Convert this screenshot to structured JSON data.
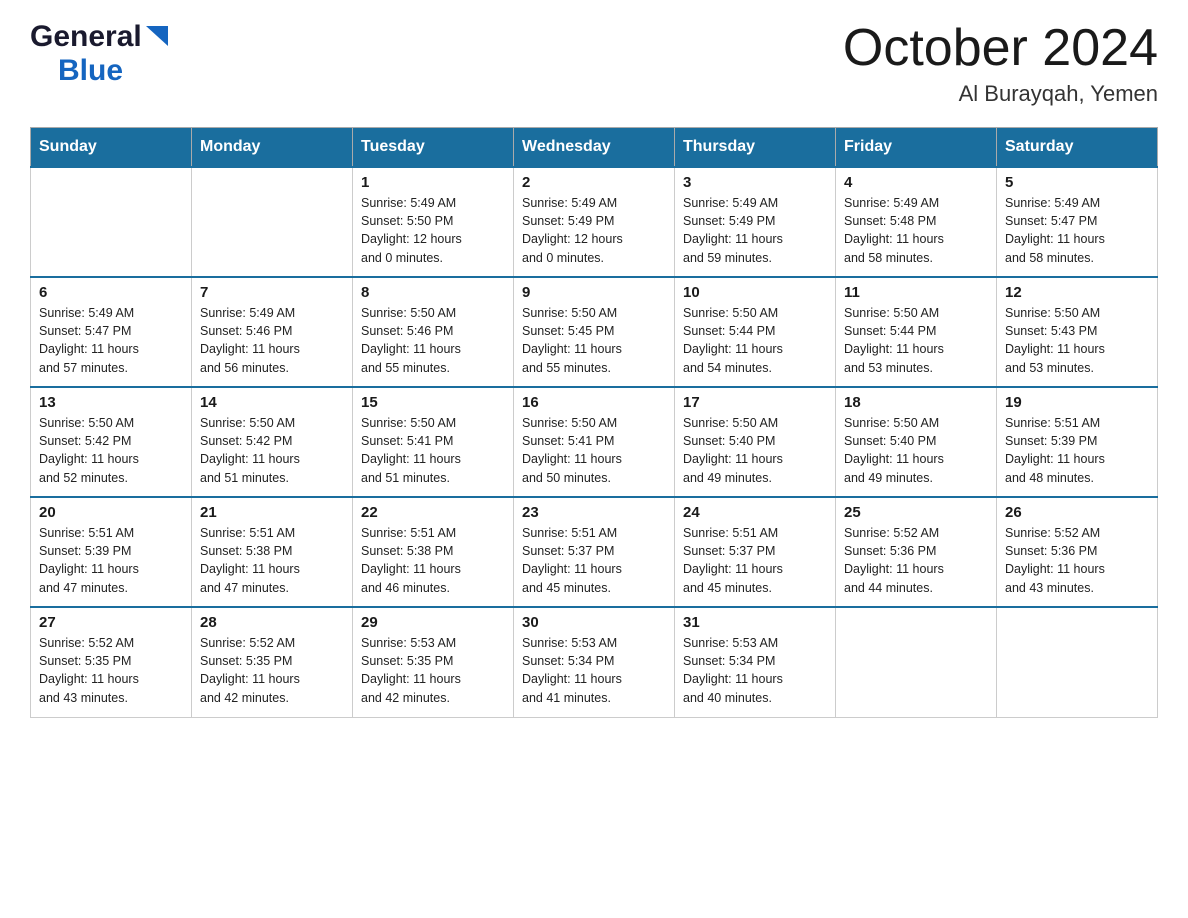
{
  "header": {
    "logo_general": "General",
    "logo_blue": "Blue",
    "month_title": "October 2024",
    "location": "Al Burayqah, Yemen"
  },
  "calendar": {
    "days_of_week": [
      "Sunday",
      "Monday",
      "Tuesday",
      "Wednesday",
      "Thursday",
      "Friday",
      "Saturday"
    ],
    "weeks": [
      [
        {
          "day": "",
          "info": ""
        },
        {
          "day": "",
          "info": ""
        },
        {
          "day": "1",
          "info": "Sunrise: 5:49 AM\nSunset: 5:50 PM\nDaylight: 12 hours\nand 0 minutes."
        },
        {
          "day": "2",
          "info": "Sunrise: 5:49 AM\nSunset: 5:49 PM\nDaylight: 12 hours\nand 0 minutes."
        },
        {
          "day": "3",
          "info": "Sunrise: 5:49 AM\nSunset: 5:49 PM\nDaylight: 11 hours\nand 59 minutes."
        },
        {
          "day": "4",
          "info": "Sunrise: 5:49 AM\nSunset: 5:48 PM\nDaylight: 11 hours\nand 58 minutes."
        },
        {
          "day": "5",
          "info": "Sunrise: 5:49 AM\nSunset: 5:47 PM\nDaylight: 11 hours\nand 58 minutes."
        }
      ],
      [
        {
          "day": "6",
          "info": "Sunrise: 5:49 AM\nSunset: 5:47 PM\nDaylight: 11 hours\nand 57 minutes."
        },
        {
          "day": "7",
          "info": "Sunrise: 5:49 AM\nSunset: 5:46 PM\nDaylight: 11 hours\nand 56 minutes."
        },
        {
          "day": "8",
          "info": "Sunrise: 5:50 AM\nSunset: 5:46 PM\nDaylight: 11 hours\nand 55 minutes."
        },
        {
          "day": "9",
          "info": "Sunrise: 5:50 AM\nSunset: 5:45 PM\nDaylight: 11 hours\nand 55 minutes."
        },
        {
          "day": "10",
          "info": "Sunrise: 5:50 AM\nSunset: 5:44 PM\nDaylight: 11 hours\nand 54 minutes."
        },
        {
          "day": "11",
          "info": "Sunrise: 5:50 AM\nSunset: 5:44 PM\nDaylight: 11 hours\nand 53 minutes."
        },
        {
          "day": "12",
          "info": "Sunrise: 5:50 AM\nSunset: 5:43 PM\nDaylight: 11 hours\nand 53 minutes."
        }
      ],
      [
        {
          "day": "13",
          "info": "Sunrise: 5:50 AM\nSunset: 5:42 PM\nDaylight: 11 hours\nand 52 minutes."
        },
        {
          "day": "14",
          "info": "Sunrise: 5:50 AM\nSunset: 5:42 PM\nDaylight: 11 hours\nand 51 minutes."
        },
        {
          "day": "15",
          "info": "Sunrise: 5:50 AM\nSunset: 5:41 PM\nDaylight: 11 hours\nand 51 minutes."
        },
        {
          "day": "16",
          "info": "Sunrise: 5:50 AM\nSunset: 5:41 PM\nDaylight: 11 hours\nand 50 minutes."
        },
        {
          "day": "17",
          "info": "Sunrise: 5:50 AM\nSunset: 5:40 PM\nDaylight: 11 hours\nand 49 minutes."
        },
        {
          "day": "18",
          "info": "Sunrise: 5:50 AM\nSunset: 5:40 PM\nDaylight: 11 hours\nand 49 minutes."
        },
        {
          "day": "19",
          "info": "Sunrise: 5:51 AM\nSunset: 5:39 PM\nDaylight: 11 hours\nand 48 minutes."
        }
      ],
      [
        {
          "day": "20",
          "info": "Sunrise: 5:51 AM\nSunset: 5:39 PM\nDaylight: 11 hours\nand 47 minutes."
        },
        {
          "day": "21",
          "info": "Sunrise: 5:51 AM\nSunset: 5:38 PM\nDaylight: 11 hours\nand 47 minutes."
        },
        {
          "day": "22",
          "info": "Sunrise: 5:51 AM\nSunset: 5:38 PM\nDaylight: 11 hours\nand 46 minutes."
        },
        {
          "day": "23",
          "info": "Sunrise: 5:51 AM\nSunset: 5:37 PM\nDaylight: 11 hours\nand 45 minutes."
        },
        {
          "day": "24",
          "info": "Sunrise: 5:51 AM\nSunset: 5:37 PM\nDaylight: 11 hours\nand 45 minutes."
        },
        {
          "day": "25",
          "info": "Sunrise: 5:52 AM\nSunset: 5:36 PM\nDaylight: 11 hours\nand 44 minutes."
        },
        {
          "day": "26",
          "info": "Sunrise: 5:52 AM\nSunset: 5:36 PM\nDaylight: 11 hours\nand 43 minutes."
        }
      ],
      [
        {
          "day": "27",
          "info": "Sunrise: 5:52 AM\nSunset: 5:35 PM\nDaylight: 11 hours\nand 43 minutes."
        },
        {
          "day": "28",
          "info": "Sunrise: 5:52 AM\nSunset: 5:35 PM\nDaylight: 11 hours\nand 42 minutes."
        },
        {
          "day": "29",
          "info": "Sunrise: 5:53 AM\nSunset: 5:35 PM\nDaylight: 11 hours\nand 42 minutes."
        },
        {
          "day": "30",
          "info": "Sunrise: 5:53 AM\nSunset: 5:34 PM\nDaylight: 11 hours\nand 41 minutes."
        },
        {
          "day": "31",
          "info": "Sunrise: 5:53 AM\nSunset: 5:34 PM\nDaylight: 11 hours\nand 40 minutes."
        },
        {
          "day": "",
          "info": ""
        },
        {
          "day": "",
          "info": ""
        }
      ]
    ]
  }
}
